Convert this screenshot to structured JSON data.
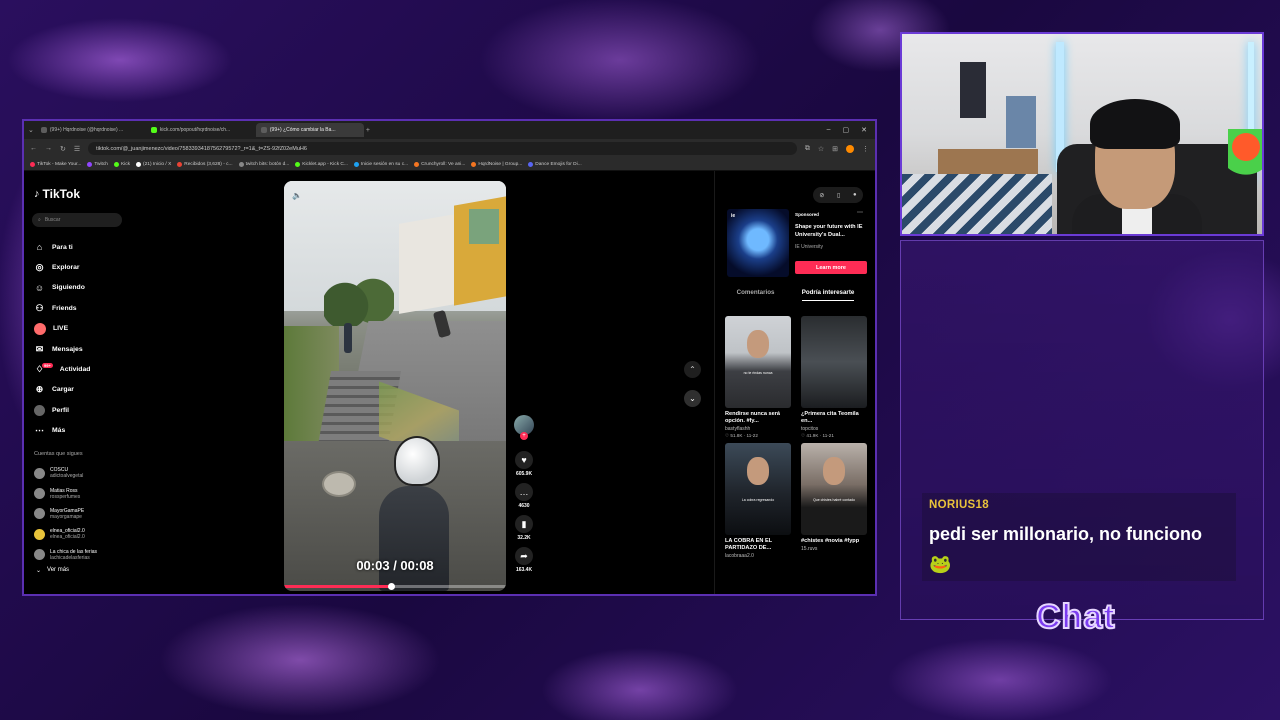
{
  "browser": {
    "tabs": [
      {
        "label": "(99+) Hqrdnoise (@hqrdnoise) ...",
        "active": false
      },
      {
        "label": "kick.com/popout/hqrdnoise/ch...",
        "active": false
      },
      {
        "label": "(99+) ¿Cómo cambiar la Ba...",
        "active": true
      }
    ],
    "new_tab": "+",
    "url": "tiktok.com/@_juanjimenezc/video/7583393418756279572?_r=1&_t=ZS-92fZ02eMuH6",
    "bookmarks": [
      "TikTok - Make Your...",
      "Twitch",
      "Kick",
      "(21) Inicio / X",
      "Recibidos (3,628) - c...",
      "twitch bits: botón d...",
      "Kicklet.app - Kick C...",
      "Inicie sesión en su c...",
      "Crunchyroll: Ve ani...",
      "HqrdNoise | Group...",
      "Dance Emojis for Di..."
    ]
  },
  "tiktok": {
    "logo": "TikTok",
    "search_placeholder": "Buscar",
    "menu": [
      {
        "label": "Para ti",
        "icon": "home-icon"
      },
      {
        "label": "Explorar",
        "icon": "compass-icon"
      },
      {
        "label": "Siguiendo",
        "icon": "following-icon"
      },
      {
        "label": "Friends",
        "icon": "friends-icon"
      },
      {
        "label": "LIVE",
        "icon": "live-icon"
      },
      {
        "label": "Mensajes",
        "icon": "messages-icon"
      },
      {
        "label": "Actividad",
        "icon": "activity-icon"
      },
      {
        "label": "Cargar",
        "icon": "upload-icon"
      },
      {
        "label": "Perfil",
        "icon": "profile-icon"
      },
      {
        "label": "Más",
        "icon": "more-icon"
      }
    ],
    "activity_badge": "99+",
    "following_title": "Cuentas que sigues",
    "following": [
      {
        "name": "COSCU",
        "handle": "adictoalvegetal"
      },
      {
        "name": "Matias Ross",
        "handle": "rossperfumes"
      },
      {
        "name": "MayorGamaPE",
        "handle": "mayorgamape"
      },
      {
        "name": "elnea_oficial2.0",
        "handle": "elnea_oficial2.0"
      },
      {
        "name": "La chica de las ferias",
        "handle": "lachicadelasferias"
      }
    ],
    "see_more": "Ver más",
    "video": {
      "time": "00:03 / 00:08",
      "progress": 0.48
    },
    "actions": {
      "likes": "605.9K",
      "comments": "4630",
      "saves": "32.2K",
      "shares": "163.4K"
    },
    "ad": {
      "sponsored": "Sponsored",
      "title": "Shape your future with IE University's Dual...",
      "brand": "IE University",
      "button": "Learn more",
      "logo_text": "ie"
    },
    "tabs": [
      "Comentarios",
      "Podría interesarte"
    ],
    "cards": [
      {
        "title": "Rendirse nunca será opción. #fy...",
        "user": "bastyflashh",
        "meta": "♡ 51.8K · 11-22",
        "caption": "no te rindas nunca"
      },
      {
        "title": "¿Primera cita Teomila en...",
        "user": "topcitos",
        "meta": "♡ 41.9K · 11-21",
        "caption": ""
      },
      {
        "title": "LA COBRA EN EL PARTIDAZO DE...",
        "user": "lacobraaa2.0",
        "meta": "",
        "caption": "La cobra regresando"
      },
      {
        "title": "#chistes #novia #fypp",
        "user": "15.ruvs",
        "meta": "",
        "caption": "Que chistes habré contado"
      }
    ]
  },
  "chat": {
    "username": "NORIUS18",
    "message": "pedi ser millonario, no funciono🐸",
    "title": "Chat"
  },
  "colors": {
    "accent": "#fe2c55",
    "chat_username": "#e9c23b",
    "frame": "#6b3bd6"
  }
}
